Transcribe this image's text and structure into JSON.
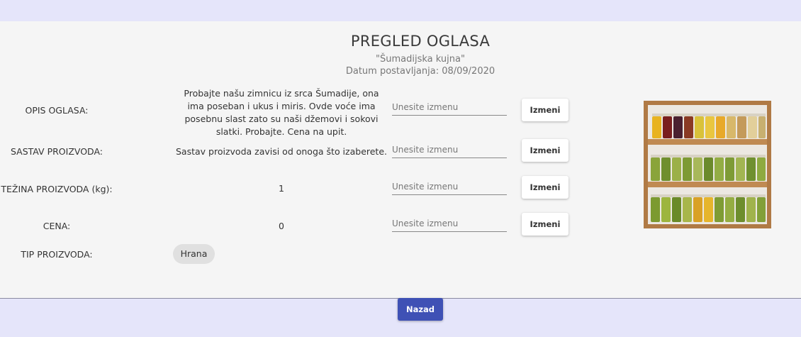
{
  "header": {
    "title": "PREGLED OGLASA",
    "shop_name": "\"Šumadijska kujna\"",
    "date_posted": "Datum postavljanja: 08/09/2020"
  },
  "rows": [
    {
      "label": "OPIS OGLASA:",
      "value": "Probajte našu zimnicu iz srca Šumadije, ona ima poseban i ukus i miris. Ovde voće ima posebnu slast zato su naši džemovi i sokovi slatki. Probajte. Cena na upit.",
      "placeholder": "Unesite izmenu",
      "button": "Izmeni"
    },
    {
      "label": "SASTAV PROIZVODA:",
      "value": "Sastav proizvoda zavisi od onoga što izaberete.",
      "placeholder": "Unesite izmenu",
      "button": "Izmeni"
    },
    {
      "label": "TEŽINA PROIZVODA (kg):",
      "value": "1",
      "placeholder": "Unesite izmenu",
      "button": "Izmeni"
    },
    {
      "label": "CENA:",
      "value": "0",
      "placeholder": "Unesite izmenu",
      "button": "Izmeni"
    }
  ],
  "product_type": {
    "label": "TIP PROIZVODA:",
    "chip": "Hrana"
  },
  "footer": {
    "back_label": "Nazad"
  },
  "colors": {
    "page_background": "#e5e5fa",
    "card_background": "#f5f5f5",
    "primary_button": "#3f51b5"
  }
}
